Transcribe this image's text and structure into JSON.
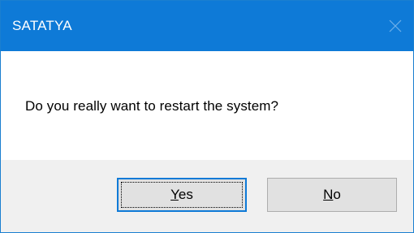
{
  "window": {
    "title": "SATATYA",
    "close_icon": "close-icon"
  },
  "message": "Do you really want to restart the system?",
  "buttons": {
    "yes": {
      "mnemonic": "Y",
      "rest": "es"
    },
    "no": {
      "mnemonic": "N",
      "rest": "o"
    }
  },
  "colors": {
    "titlebar": "#0e7ad7",
    "footer": "#f0f0f0",
    "button_face": "#e1e1e1",
    "default_button_border": "#0e7ad7"
  }
}
